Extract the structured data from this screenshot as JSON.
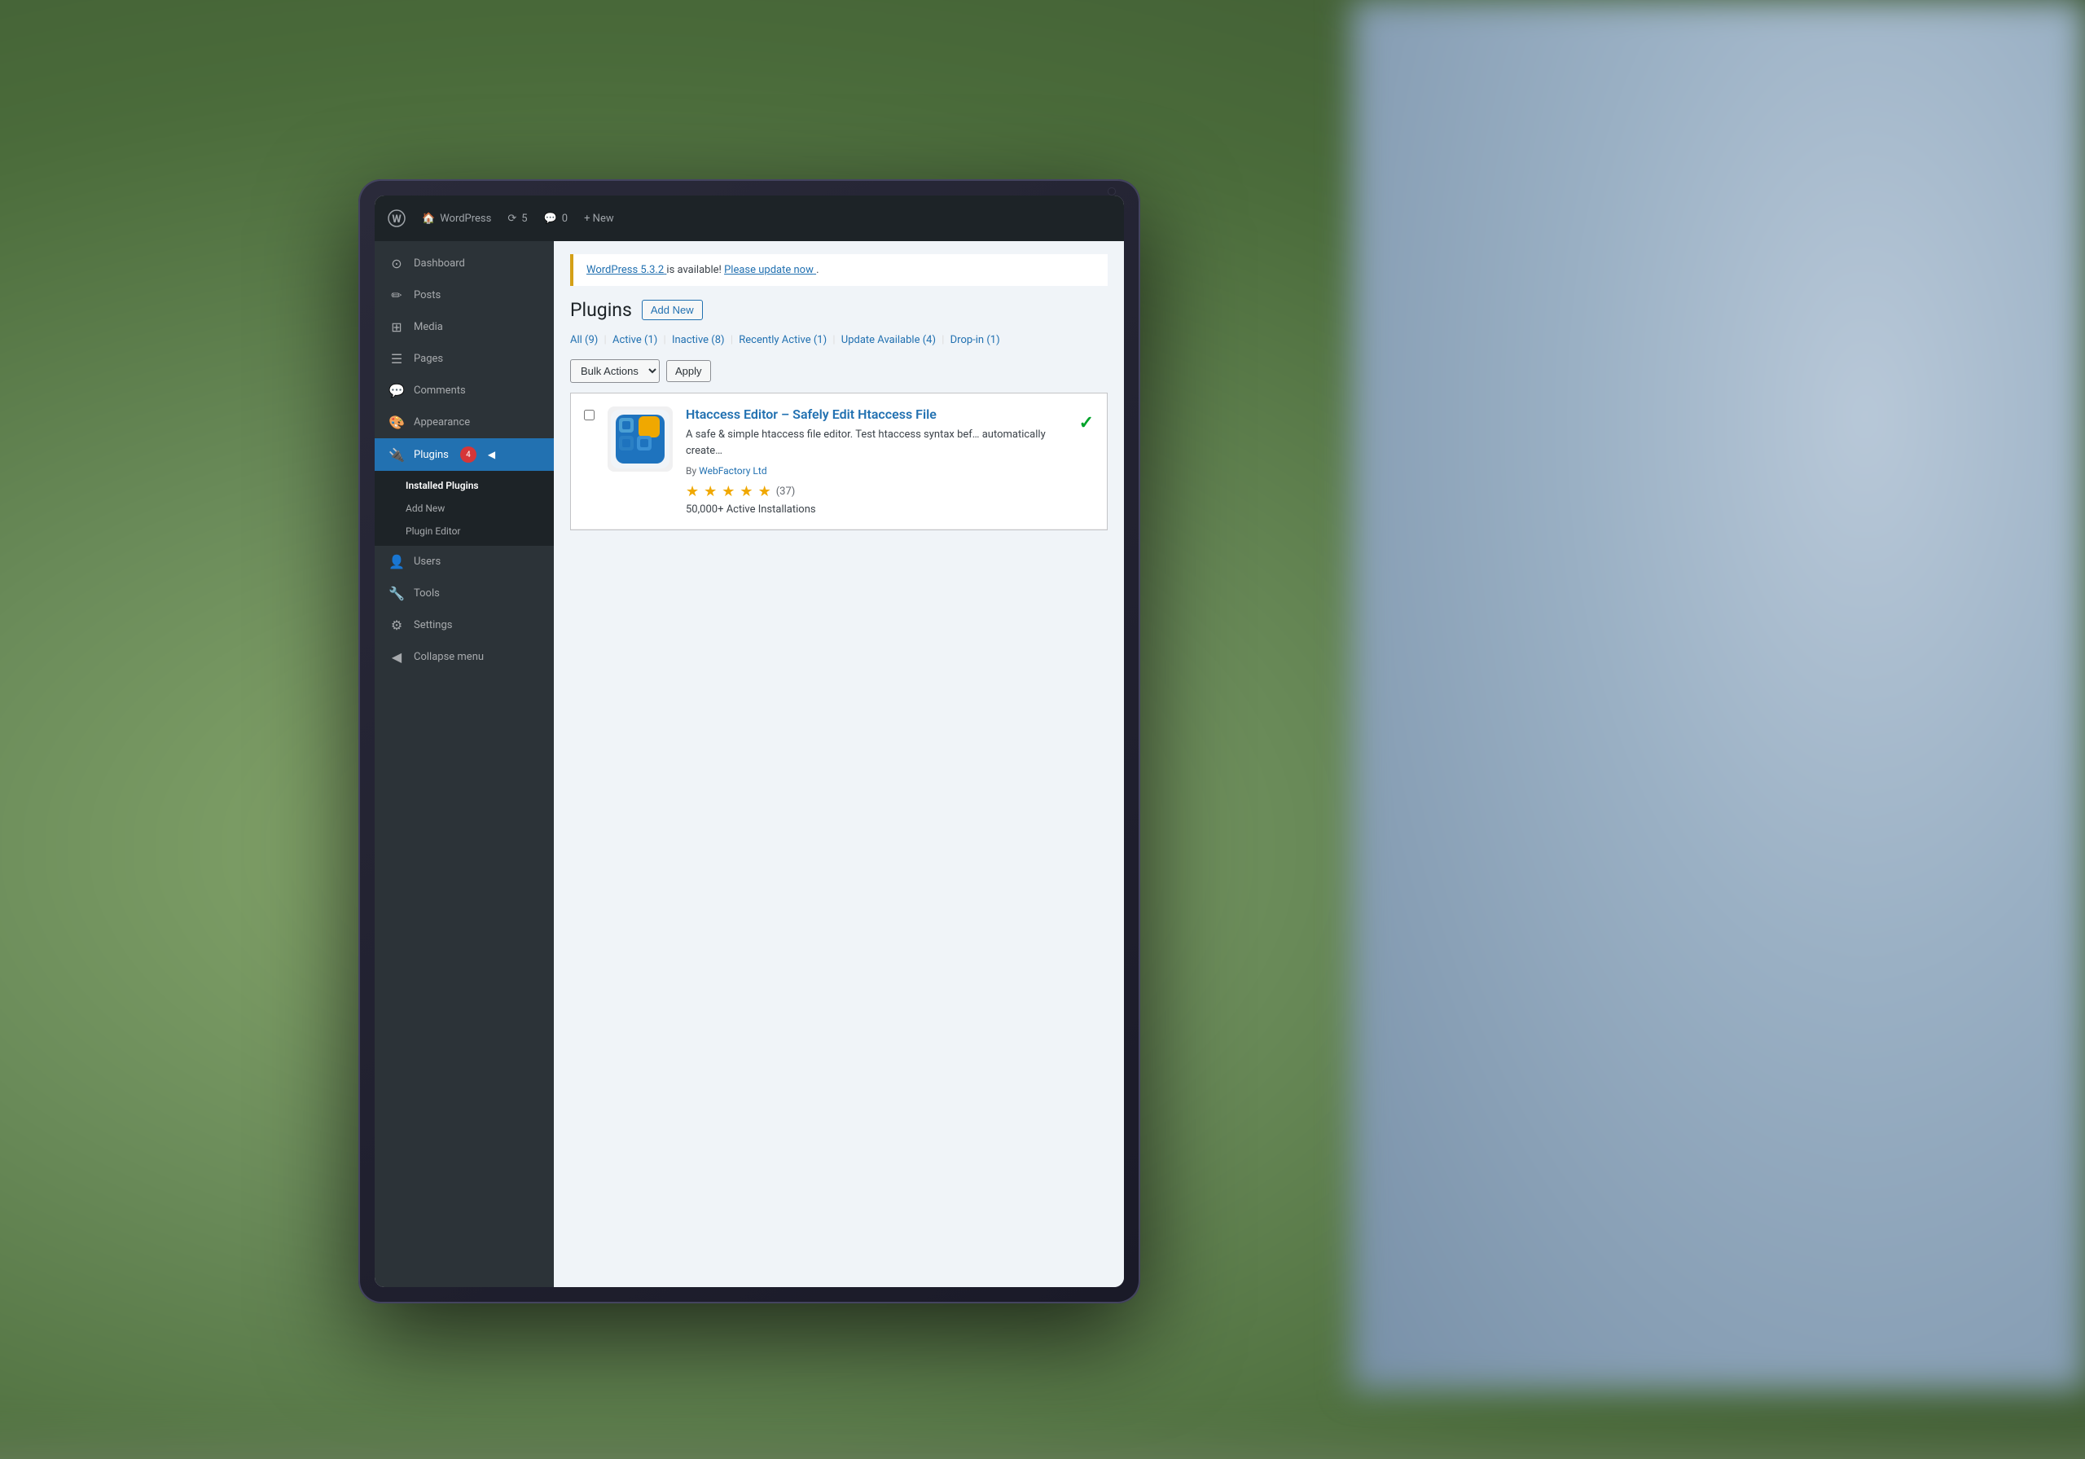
{
  "background": {
    "color_left": "#6b8c5a",
    "color_right": "#9ab0c4"
  },
  "admin_bar": {
    "wp_icon": "⊕",
    "site_label": "WordPress",
    "updates_count": "5",
    "comments_count": "0",
    "new_label": "+ New"
  },
  "sidebar": {
    "items": [
      {
        "id": "dashboard",
        "label": "Dashboard",
        "icon": "⊙"
      },
      {
        "id": "posts",
        "label": "Posts",
        "icon": "✏"
      },
      {
        "id": "media",
        "label": "Media",
        "icon": "⊞"
      },
      {
        "id": "pages",
        "label": "Pages",
        "icon": "☰"
      },
      {
        "id": "comments",
        "label": "Comments",
        "icon": "💬"
      },
      {
        "id": "appearance",
        "label": "Appearance",
        "icon": "🎨"
      },
      {
        "id": "plugins",
        "label": "Plugins",
        "icon": "🔌",
        "badge": "4",
        "active": true
      },
      {
        "id": "users",
        "label": "Users",
        "icon": "👤"
      },
      {
        "id": "tools",
        "label": "Tools",
        "icon": "🔧"
      },
      {
        "id": "settings",
        "label": "Settings",
        "icon": "⚙"
      },
      {
        "id": "collapse",
        "label": "Collapse menu",
        "icon": "◀"
      }
    ],
    "plugins_sub": [
      {
        "id": "installed",
        "label": "Installed Plugins",
        "active": true
      },
      {
        "id": "add_new",
        "label": "Add New"
      },
      {
        "id": "editor",
        "label": "Plugin Editor"
      }
    ]
  },
  "update_notice": {
    "version_link_text": "WordPress 5.3.2",
    "message": " is available! ",
    "update_link_text": "Please update now"
  },
  "page": {
    "title": "Plugins",
    "add_new_button": "Add New"
  },
  "filter_bar": {
    "filters": [
      {
        "label": "All",
        "count": "9"
      },
      {
        "label": "Active",
        "count": "1"
      },
      {
        "label": "Inactive",
        "count": "8"
      },
      {
        "label": "Recently Active",
        "count": "1"
      },
      {
        "label": "Update Available",
        "count": "4"
      },
      {
        "label": "Drop-in",
        "count": "1"
      }
    ]
  },
  "bulk_actions": {
    "select_label": "Bulk Actions",
    "apply_label": "Apply",
    "dropdown_icon": "▼"
  },
  "plugin": {
    "name": "Htaccess Editor – Safely Edit Htaccess File",
    "description": "A safe & simple htaccess file editor. Test htaccess syntax bef… automatically create…",
    "author": "By WebFactory Ltd",
    "author_link": "WebFactory Ltd",
    "stars": [
      "★",
      "★",
      "★",
      "★",
      "★"
    ],
    "rating_count": "(37)",
    "installs": "50,000+ Active Installations",
    "active_check": "✓"
  }
}
